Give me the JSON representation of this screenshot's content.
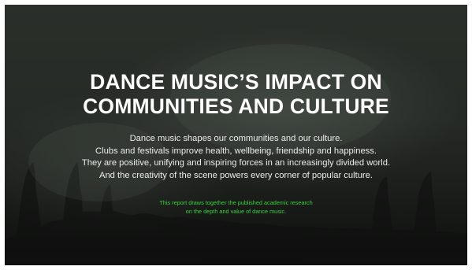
{
  "slide": {
    "title_lines": [
      "DANCE MUSIC’S IMPACT ON",
      "COMMUNITIES AND CULTURE"
    ],
    "body_lines": [
      "Dance music shapes our communities and our culture.",
      "Clubs and festivals improve health, wellbeing, friendship and happiness.",
      "They are positive, unifying and inspiring forces in an increasingly divided world.",
      "And the creativity of the scene powers every corner of popular culture."
    ],
    "note_lines": [
      "This report draws together the published academic research",
      "on the depth and value of dance music."
    ],
    "colors": {
      "background": "#262a26",
      "title": "#ffffff",
      "body": "#ececec",
      "note": "#39d33b"
    }
  }
}
